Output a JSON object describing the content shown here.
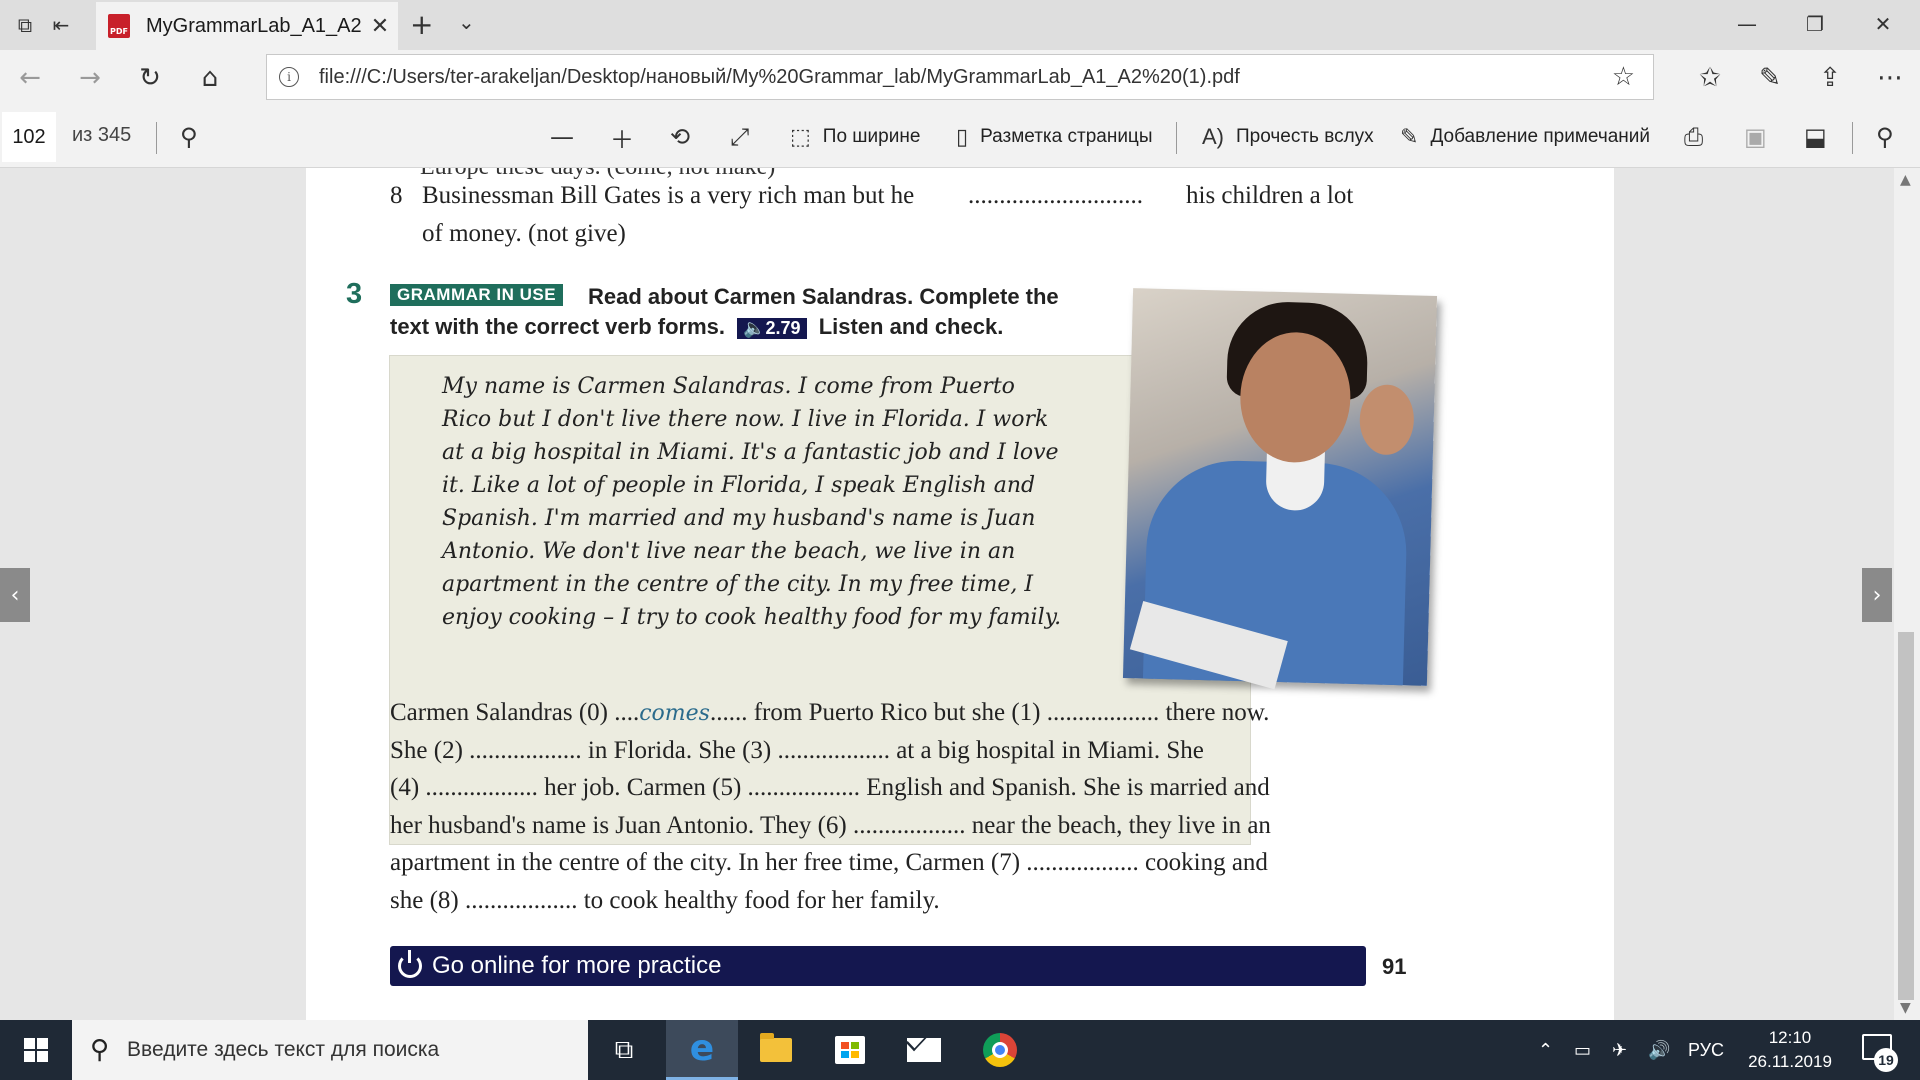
{
  "browser": {
    "tab_title": "MyGrammarLab_A1_A2",
    "tab_close": "✕",
    "new_tab": "+",
    "address_url": "file:///C:/Users/ter-arakeljan/Desktop/нановый/My%20Grammar_lab/MyGrammarLab_A1_A2%20(1).pdf"
  },
  "pdf_toolbar": {
    "current_page": "102",
    "page_total": "из 345",
    "fit_width": "По ширине",
    "page_layout": "Разметка страницы",
    "read_aloud": "Прочесть вслух",
    "add_notes": "Добавление примечаний"
  },
  "document": {
    "prev_fragment": "Europe these days. (come, not make)",
    "item8_num": "8",
    "item8_line1_a": "Businessman Bill Gates is a very rich man but he",
    "item8_line1_blank": "............................",
    "item8_line1_b": "his children a lot",
    "item8_line2": "of money. (not give)",
    "exercise_number": "3",
    "badge": "GRAMMAR IN USE",
    "instruction_line1": "Read about Carmen Salandras. Complete the",
    "instruction_line2_a": "text with the correct verb forms.",
    "audio_track": "2.79",
    "instruction_line2_b": "Listen and check.",
    "note_text": "My name is Carmen Salandras. I come from Puerto Rico but I don't live there now. I live in Florida. I work at a big hospital in Miami. It's a fantastic job and I love it. Like a lot of people in Florida, I speak English and Spanish. I'm married and my husband's name is Juan Antonio. We don't live near the beach, we live in an apartment in the centre of the city. In my free time, I enjoy cooking – I try to cook healthy food for my family.",
    "para_line1_a": "Carmen Salandras (0)",
    "para_line1_answer": "comes",
    "para_line1_b": "from Puerto Rico but she (1) .................. there now.",
    "para_line2": "She (2) .................. in Florida. She (3) .................. at a big hospital in Miami. She",
    "para_line3": "(4) .................. her job. Carmen (5) .................. English and Spanish. She is married and",
    "para_line4": "her husband's name is Juan Antonio. They (6) .................. near the beach, they live in an",
    "para_line5": "apartment in the centre of the city. In her free time, Carmen (7) .................. cooking and",
    "para_line6": "she (8) .................. to cook healthy food for her family.",
    "go_online": "Go online for more practice",
    "page_number": "91"
  },
  "taskbar": {
    "search_placeholder": "Введите здесь текст для поиска",
    "language": "РУС",
    "time": "12:10",
    "date": "26.11.2019",
    "notifications": "19"
  },
  "colors": {
    "accent_green": "#1f6e5c",
    "navy": "#14174f",
    "taskbar": "#1f2936"
  }
}
